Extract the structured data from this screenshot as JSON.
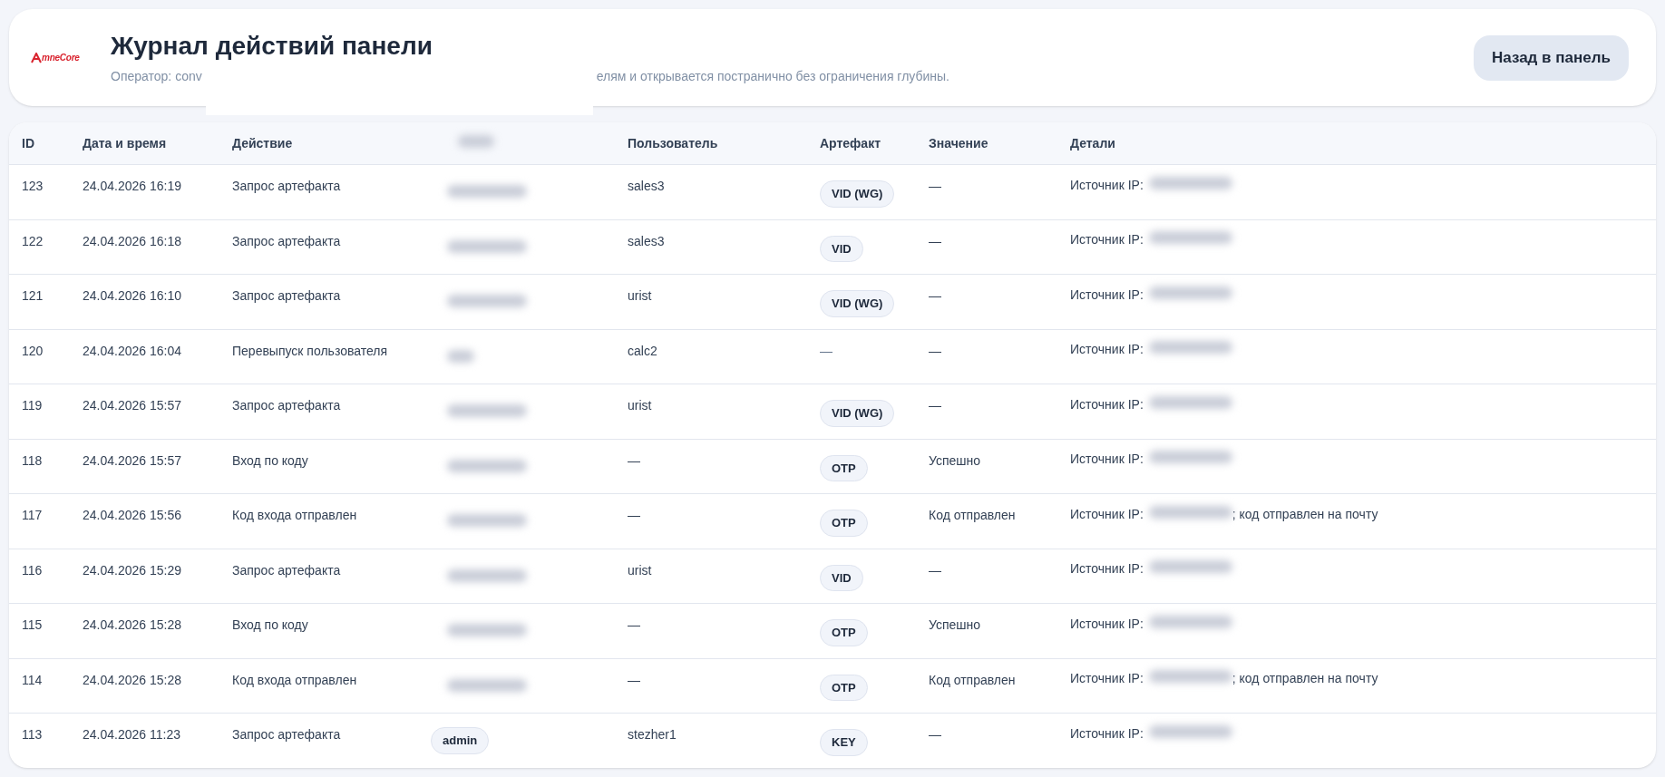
{
  "header": {
    "logo_text": "mneCore",
    "title": "Журнал действий панели",
    "subtitle_start": "Оператор: conv",
    "subtitle_end": "елям и открывается постранично без ограничения глубины.",
    "back_button": "Назад в панель"
  },
  "table": {
    "columns": [
      {
        "label": "ID",
        "kind": "text"
      },
      {
        "label": "Дата и время",
        "kind": "text"
      },
      {
        "label": "Действие",
        "kind": "text"
      },
      {
        "kind": "blurred"
      },
      {
        "label": "Пользователь",
        "kind": "text"
      },
      {
        "label": "Артефакт",
        "kind": "text"
      },
      {
        "label": "Значение",
        "kind": "text"
      },
      {
        "label": "Детали",
        "kind": "text"
      }
    ],
    "rows": [
      {
        "id": "123",
        "datetime": "24.04.2026 16:19",
        "action": "Запрос артефакта",
        "column_4": {
          "kind": "blurred"
        },
        "user": "sales3",
        "artifact": {
          "kind": "badge",
          "text": "VID (WG)"
        },
        "value": "—",
        "details": {
          "prefix": "Источник IP:"
        }
      },
      {
        "id": "122",
        "datetime": "24.04.2026 16:18",
        "action": "Запрос артефакта",
        "column_4": {
          "kind": "blurred"
        },
        "user": "sales3",
        "artifact": {
          "kind": "badge",
          "text": "VID"
        },
        "value": "—",
        "details": {
          "prefix": "Источник IP:"
        }
      },
      {
        "id": "121",
        "datetime": "24.04.2026 16:10",
        "action": "Запрос артефакта",
        "column_4": {
          "kind": "blurred"
        },
        "user": "urist",
        "artifact": {
          "kind": "badge",
          "text": "VID (WG)"
        },
        "value": "—",
        "details": {
          "prefix": "Источник IP:"
        }
      },
      {
        "id": "120",
        "datetime": "24.04.2026 16:04",
        "action": "Перевыпуск пользователя",
        "column_4": {
          "kind": "blurred_short"
        },
        "user": "calc2",
        "artifact": {
          "kind": "plain",
          "text": "—"
        },
        "value": "—",
        "details": {
          "prefix": "Источник IP:"
        }
      },
      {
        "id": "119",
        "datetime": "24.04.2026 15:57",
        "action": "Запрос артефакта",
        "column_4": {
          "kind": "blurred"
        },
        "user": "urist",
        "artifact": {
          "kind": "badge",
          "text": "VID (WG)"
        },
        "value": "—",
        "details": {
          "prefix": "Источник IP:"
        }
      },
      {
        "id": "118",
        "datetime": "24.04.2026 15:57",
        "action": "Вход по коду",
        "column_4": {
          "kind": "blurred"
        },
        "user": "—",
        "artifact": {
          "kind": "badge",
          "text": "OTP"
        },
        "value": "Успешно",
        "details": {
          "prefix": "Источник IP:"
        }
      },
      {
        "id": "117",
        "datetime": "24.04.2026 15:56",
        "action": "Код входа отправлен",
        "column_4": {
          "kind": "blurred"
        },
        "user": "—",
        "artifact": {
          "kind": "badge",
          "text": "OTP"
        },
        "value": "Код отправлен",
        "details": {
          "prefix": "Источник IP:",
          "suffix": "; код отправлен на почту"
        }
      },
      {
        "id": "116",
        "datetime": "24.04.2026 15:29",
        "action": "Запрос артефакта",
        "column_4": {
          "kind": "blurred"
        },
        "user": "urist",
        "artifact": {
          "kind": "badge",
          "text": "VID"
        },
        "value": "—",
        "details": {
          "prefix": "Источник IP:"
        }
      },
      {
        "id": "115",
        "datetime": "24.04.2026 15:28",
        "action": "Вход по коду",
        "column_4": {
          "kind": "blurred"
        },
        "user": "—",
        "artifact": {
          "kind": "badge",
          "text": "OTP"
        },
        "value": "Успешно",
        "details": {
          "prefix": "Источник IP:"
        }
      },
      {
        "id": "114",
        "datetime": "24.04.2026 15:28",
        "action": "Код входа отправлен",
        "column_4": {
          "kind": "blurred"
        },
        "user": "—",
        "artifact": {
          "kind": "badge",
          "text": "OTP"
        },
        "value": "Код отправлен",
        "details": {
          "prefix": "Источник IP:",
          "suffix": "; код отправлен на почту"
        }
      },
      {
        "id": "113",
        "datetime": "24.04.2026 11:23",
        "action": "Запрос артефакта",
        "column_4": {
          "kind": "badge",
          "text": "admin"
        },
        "user": "stezher1",
        "artifact": {
          "kind": "badge",
          "text": "KEY"
        },
        "value": "—",
        "details": {
          "prefix": "Источник IP:"
        }
      }
    ]
  }
}
